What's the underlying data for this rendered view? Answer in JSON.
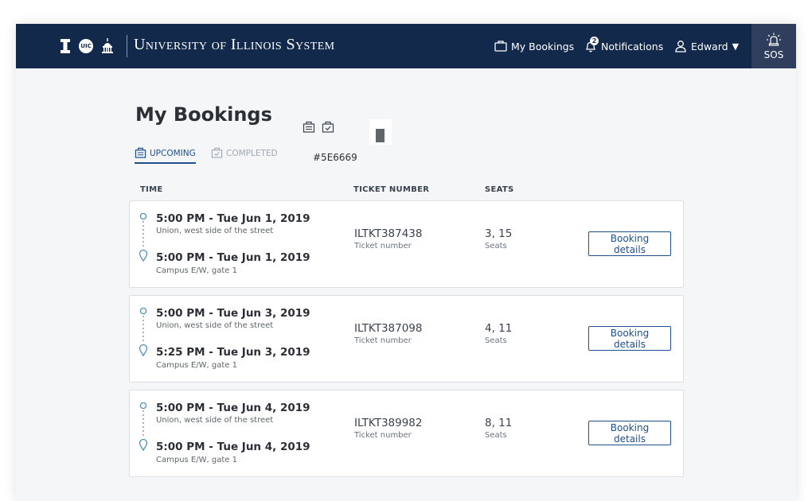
{
  "header": {
    "logo_text": "UIC",
    "brand": "University of Illinois System",
    "nav": {
      "bookings": "My Bookings",
      "notifications": "Notifications",
      "notifications_count": "2",
      "user": "Edward"
    },
    "sos": "SOS"
  },
  "page": {
    "title": "My Bookings",
    "color_label": "#5E6669",
    "tabs": {
      "upcoming": "UPCOMING",
      "completed": "COMPLETED"
    },
    "columns": {
      "time": "TIME",
      "ticket": "TICKET NUMBER",
      "seats": "SEATS"
    },
    "bookings": [
      {
        "depart_time": "5:00 PM - Tue Jun 1, 2019",
        "depart_place": "Union, west side of the street",
        "arrive_time": "5:00 PM - Tue Jun 1, 2019",
        "arrive_place": "Campus E/W, gate 1",
        "ticket": "ILTKT387438",
        "ticket_label": "Ticket number",
        "seats": "3, 15",
        "seats_label": "Seats",
        "button": "Booking details"
      },
      {
        "depart_time": "5:00 PM - Tue Jun 3, 2019",
        "depart_place": "Union, west side of the street",
        "arrive_time": "5:25 PM - Tue Jun 3, 2019",
        "arrive_place": "Campus E/W, gate 1",
        "ticket": "ILTKT387098",
        "ticket_label": "Ticket number",
        "seats": "4, 11",
        "seats_label": "Seats",
        "button": "Booking details"
      },
      {
        "depart_time": "5:00 PM - Tue Jun 4, 2019",
        "depart_place": "Union, west side of the street",
        "arrive_time": "5:00 PM - Tue Jun 4, 2019",
        "arrive_place": "Campus E/W, gate 1",
        "ticket": "ILTKT389982",
        "ticket_label": "Ticket number",
        "seats": "8, 11",
        "seats_label": "Seats",
        "button": "Booking details"
      }
    ]
  },
  "colors": {
    "navy": "#13294b",
    "sos_bg": "#2e3e5c",
    "accent_blue": "#1d4f91",
    "swatch": "#5e6669",
    "route_teal": "#4a90b8"
  },
  "icons": {
    "logo_mark": "block-i-icon",
    "logo_dome": "capitol-dome-icon",
    "bookings": "briefcase-icon",
    "notifications": "bell-icon",
    "user": "user-icon",
    "sos": "siren-icon",
    "upcoming": "ticket-list-icon",
    "completed": "ticket-check-icon",
    "route_start": "circle-marker-icon",
    "route_end": "location-pin-icon"
  }
}
